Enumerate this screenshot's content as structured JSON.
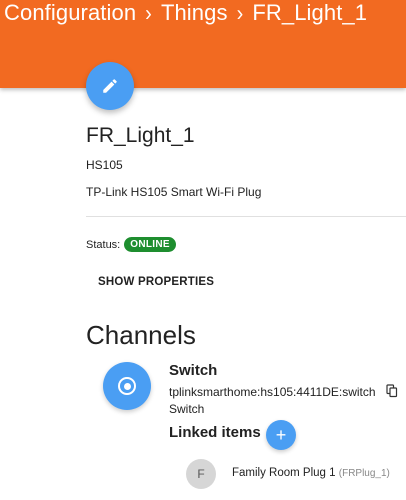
{
  "breadcrumb": {
    "items": [
      "Configuration",
      "Things",
      "FR_Light_1"
    ],
    "separator": "›"
  },
  "thing": {
    "name": "FR_Light_1",
    "model": "HS105",
    "description": "TP-Link HS105 Smart Wi-Fi Plug",
    "status_label": "Status:",
    "status": "ONLINE",
    "show_properties_label": "SHOW PROPERTIES"
  },
  "channels": {
    "title": "Channels",
    "items": [
      {
        "name": "Switch",
        "uid": "tplinksmarthome:hs105:4411DE:switch",
        "type": "Switch",
        "linked_items_title": "Linked items",
        "linked_items": [
          {
            "avatar_letter": "F",
            "label": "Family Room Plug 1",
            "item_name": "(FRPlug_1)"
          }
        ]
      }
    ]
  },
  "icons": {
    "edit": "pencil-icon",
    "channel": "radio-button-icon",
    "copy": "copy-icon",
    "add": "plus-icon"
  },
  "colors": {
    "topbar": "#f26a21",
    "accent": "#4a9ef3",
    "status_online": "#1e8e2f"
  }
}
